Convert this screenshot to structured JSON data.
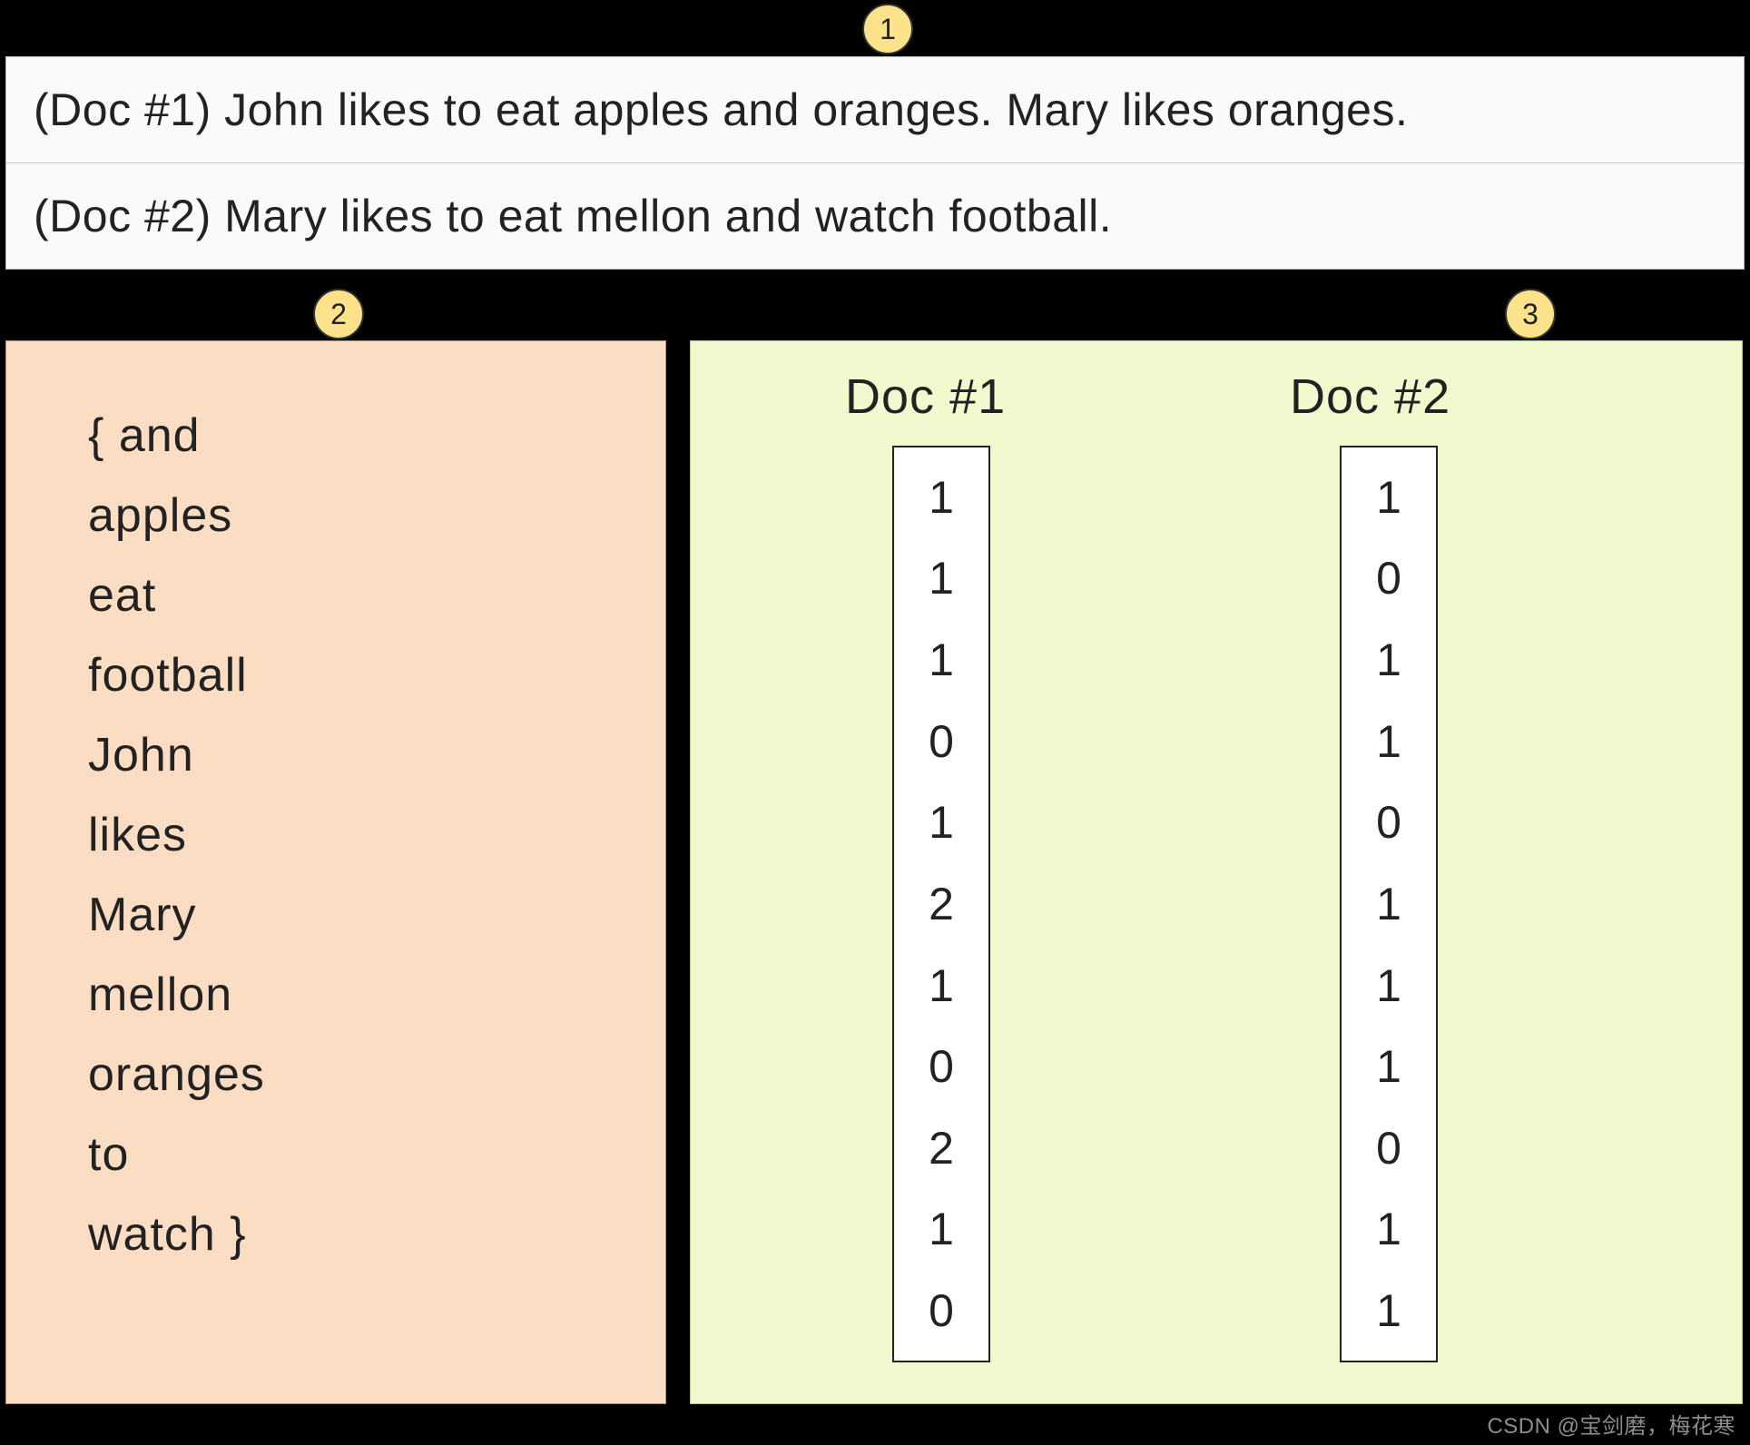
{
  "badges": {
    "one": "1",
    "two": "2",
    "three": "3"
  },
  "docs": {
    "doc1": "(Doc #1) John likes to eat apples and oranges. Mary likes oranges.",
    "doc2": "(Doc #2) Mary likes to eat mellon and watch football."
  },
  "vocab": {
    "l0": "{ and",
    "l1": "apples",
    "l2": "eat",
    "l3": "football",
    "l4": "John",
    "l5": "likes",
    "l6": "Mary",
    "l7": "mellon",
    "l8": "oranges",
    "l9": "to",
    "l10": "watch }"
  },
  "vectors": {
    "header1": "Doc #1",
    "header2": "Doc #2",
    "v1": [
      "1",
      "1",
      "1",
      "0",
      "1",
      "2",
      "1",
      "0",
      "2",
      "1",
      "0"
    ],
    "v2": [
      "1",
      "0",
      "1",
      "1",
      "0",
      "1",
      "1",
      "1",
      "0",
      "1",
      "1"
    ]
  },
  "watermark": "CSDN @宝剑磨，梅花寒"
}
